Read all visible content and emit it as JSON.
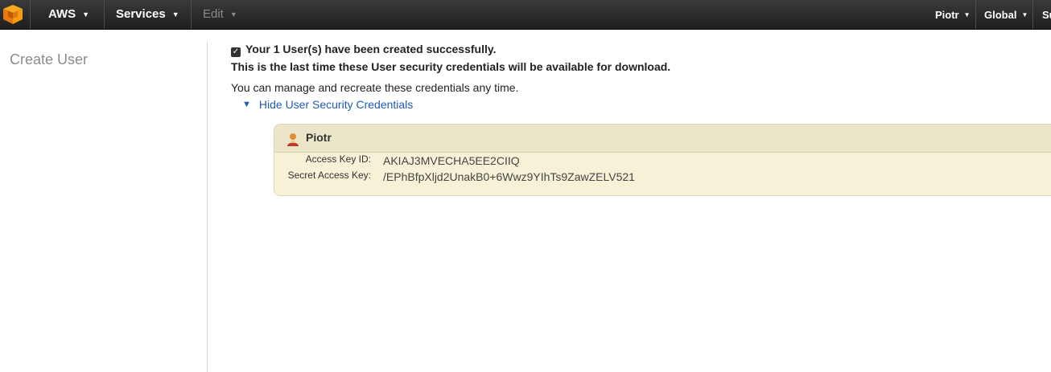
{
  "topbar": {
    "brand": "AWS",
    "services": "Services",
    "edit": "Edit",
    "user": "Piotr",
    "region": "Global",
    "support": "Su"
  },
  "sidebar": {
    "title": "Create User"
  },
  "main": {
    "success_message": "Your 1 User(s) have been created successfully.",
    "warning_message": "This is the last time these User security credentials will be available for download.",
    "info_message": "You can manage and recreate these credentials any time.",
    "toggle_label": "Hide User Security Credentials"
  },
  "credentials": {
    "user_name": "Piotr",
    "access_key_label": "Access Key ID:",
    "access_key_value": "AKIAJ3MVECHA5EE2CIIQ",
    "secret_key_label": "Secret Access Key:",
    "secret_key_value": "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"
  },
  "colors": {
    "topbar": "#2b2b2b",
    "link": "#1f5bb5",
    "panel_bg": "#f7f2d7",
    "panel_header": "#ebe6c9"
  }
}
